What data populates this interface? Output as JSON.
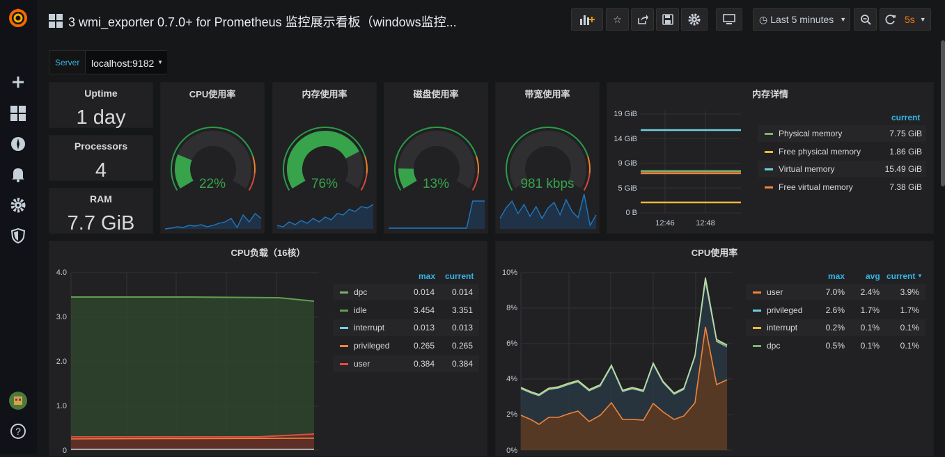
{
  "header": {
    "title": "3 wmi_exporter 0.7.0+ for Prometheus 监控展示看板（windows监控...",
    "time_range": "Last 5 minutes",
    "refresh": "5s"
  },
  "variables": {
    "server_label": "Server",
    "server_value": "localhost:9182"
  },
  "stats": {
    "uptime_title": "Uptime",
    "uptime_value": "1 day",
    "processors_title": "Processors",
    "processors_value": "4",
    "ram_title": "RAM",
    "ram_value": "7.7 GiB"
  },
  "gauges": [
    {
      "title": "CPU使用率",
      "value": "22%",
      "fraction": 0.22,
      "color": "#37a34a"
    },
    {
      "title": "内存使用率",
      "value": "76%",
      "fraction": 0.76,
      "color": "#37a34a"
    },
    {
      "title": "磁盘使用率",
      "value": "13%",
      "fraction": 0.13,
      "color": "#37a34a"
    },
    {
      "title": "带宽使用率",
      "value": "981 kbps",
      "fraction": 0.0,
      "color": "#37a34a"
    }
  ],
  "memory": {
    "title": "内存详情",
    "yticks": [
      "19 GiB",
      "14 GiB",
      "9 GiB",
      "5 GiB",
      "0 B"
    ],
    "xticks": [
      "12:46",
      "12:48"
    ],
    "header_current": "current",
    "series": [
      {
        "name": "Physical memory",
        "current": "7.75 GiB",
        "color": "#7eb26d"
      },
      {
        "name": "Free physical memory",
        "current": "1.86 GiB",
        "color": "#eab839"
      },
      {
        "name": "Virtual memory",
        "current": "15.49 GiB",
        "color": "#6ed0e0"
      },
      {
        "name": "Free virtual memory",
        "current": "7.38 GiB",
        "color": "#ef843c"
      }
    ]
  },
  "cpu_load": {
    "title": "CPU负载（16核）",
    "yticks": [
      "4.0",
      "3.0",
      "2.0",
      "1.0",
      "0"
    ],
    "header_max": "max",
    "header_current": "current",
    "series": [
      {
        "name": "dpc",
        "max": "0.014",
        "current": "0.014",
        "color": "#7eb26d"
      },
      {
        "name": "idle",
        "max": "3.454",
        "current": "3.351",
        "color": "#629e51"
      },
      {
        "name": "interrupt",
        "max": "0.013",
        "current": "0.013",
        "color": "#6ed0e0"
      },
      {
        "name": "privileged",
        "max": "0.265",
        "current": "0.265",
        "color": "#ef843c"
      },
      {
        "name": "user",
        "max": "0.384",
        "current": "0.384",
        "color": "#e24d42"
      }
    ]
  },
  "cpu_usage": {
    "title": "CPU使用率",
    "yticks": [
      "10%",
      "8%",
      "6%",
      "4%",
      "2%",
      "0%"
    ],
    "header_max": "max",
    "header_avg": "avg",
    "header_current": "current",
    "series": [
      {
        "name": "user",
        "max": "7.0%",
        "avg": "2.4%",
        "current": "3.9%",
        "color": "#ef843c"
      },
      {
        "name": "privileged",
        "max": "2.6%",
        "avg": "1.7%",
        "current": "1.7%",
        "color": "#6ed0e0"
      },
      {
        "name": "interrupt",
        "max": "0.2%",
        "avg": "0.1%",
        "current": "0.1%",
        "color": "#eab839"
      },
      {
        "name": "dpc",
        "max": "0.5%",
        "avg": "0.1%",
        "current": "0.1%",
        "color": "#7eb26d"
      }
    ]
  }
}
